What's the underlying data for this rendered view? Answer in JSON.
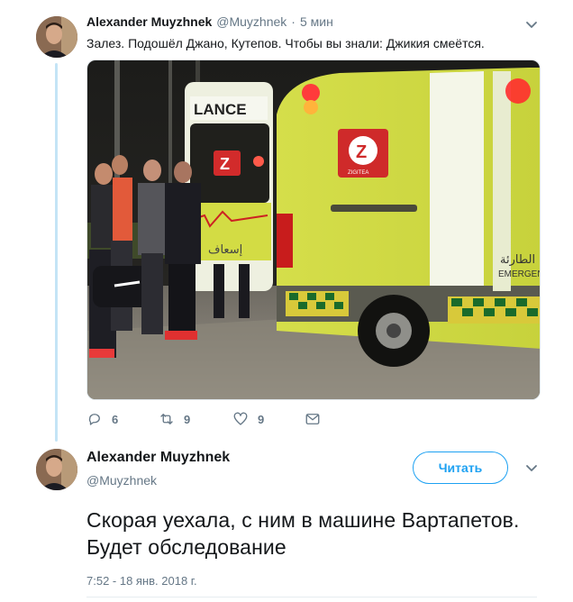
{
  "tweet1": {
    "author_name": "Alexander Muyzhnek",
    "author_handle": "@Muyzhnek",
    "separator": "·",
    "time": "5 мин",
    "text": "Залез. Подошёл Джано, Кутепов. Чтобы вы знали: Джикия смеётся.",
    "photo_labels": {
      "ambulance_partial": "LANCE",
      "emergency_partial": "EMERGEN",
      "arabic_text": "الطارئة",
      "arabic_side": "إسعاف",
      "logo_caption": "ZIGITEA"
    },
    "actions": {
      "replies": "6",
      "retweets": "9",
      "likes": "9"
    }
  },
  "tweet2": {
    "author_name": "Alexander Muyzhnek",
    "author_handle": "@Muyzhnek",
    "follow_label": "Читать",
    "text": "Скорая уехала, с ним в машине Вартапетов. Будет обследование",
    "timestamp": "7:52 - 18 янв. 2018 г."
  },
  "colors": {
    "accent": "#1da1f2",
    "thread_line": "#c4e4f6",
    "muted": "#657786"
  },
  "icons": [
    "reply-icon",
    "retweet-icon",
    "like-icon",
    "message-icon",
    "chevron-down-icon"
  ]
}
